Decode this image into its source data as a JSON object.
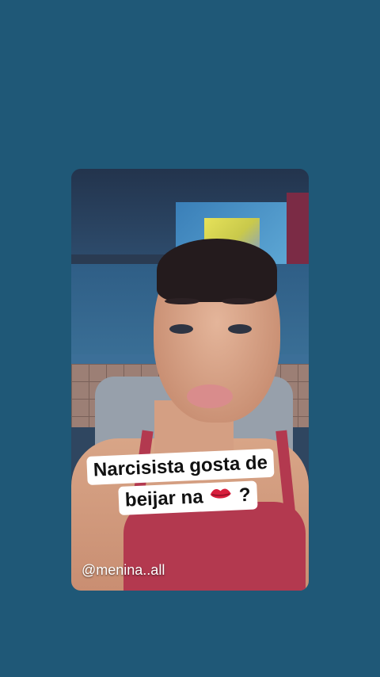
{
  "caption": {
    "line1": "Narcisista gosta de",
    "line2_text": "beijar na",
    "line2_icon": "lips-emoji-icon",
    "line2_end": "?"
  },
  "username": "@menina..all",
  "colors": {
    "background": "#1f5877",
    "caption_bg": "#ffffff",
    "caption_text": "#111111",
    "emoji": "#d81e3c"
  }
}
